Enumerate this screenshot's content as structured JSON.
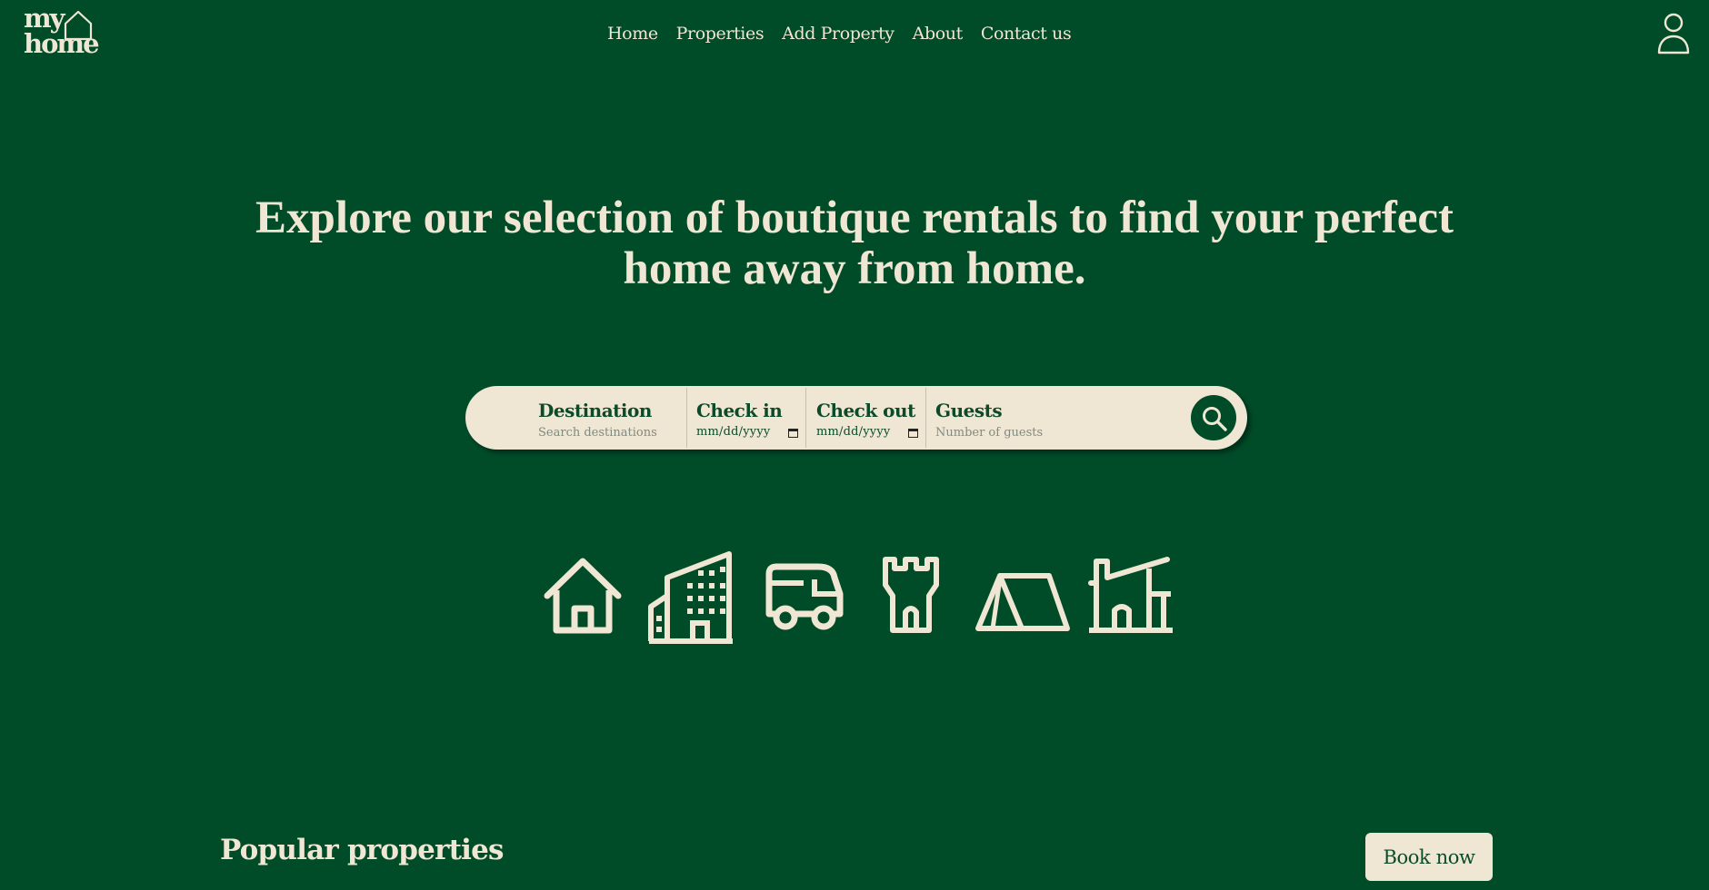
{
  "logo": {
    "line1": "my",
    "line2": "home",
    "icon": "house-outline-icon"
  },
  "nav": {
    "items": [
      {
        "label": "Home"
      },
      {
        "label": "Properties"
      },
      {
        "label": "Add Property"
      },
      {
        "label": "About"
      },
      {
        "label": "Contact us"
      }
    ]
  },
  "header": {
    "user_icon": "user-account-icon"
  },
  "hero": {
    "title": "Explore our selection of boutique rentals to find your perfect home away from home."
  },
  "search": {
    "destination": {
      "label": "Destination",
      "placeholder": "Search destinations"
    },
    "checkin": {
      "label": "Check in",
      "value": "mm/dd/yyyy"
    },
    "checkout": {
      "label": "Check out",
      "value": "mm/dd/yyyy"
    },
    "guests": {
      "label": "Guests",
      "placeholder": "Number of guests"
    },
    "button_icon": "search-icon"
  },
  "categories": [
    {
      "icon": "house-icon"
    },
    {
      "icon": "apartment-building-icon"
    },
    {
      "icon": "camper-van-icon"
    },
    {
      "icon": "castle-tower-icon"
    },
    {
      "icon": "tent-icon"
    },
    {
      "icon": "cabin-icon"
    }
  ],
  "popular": {
    "title": "Popular properties",
    "book_label": "Book now"
  },
  "colors": {
    "background": "#004b28",
    "cream": "#efe6d3",
    "dark_green_text": "#0b4b2a"
  }
}
